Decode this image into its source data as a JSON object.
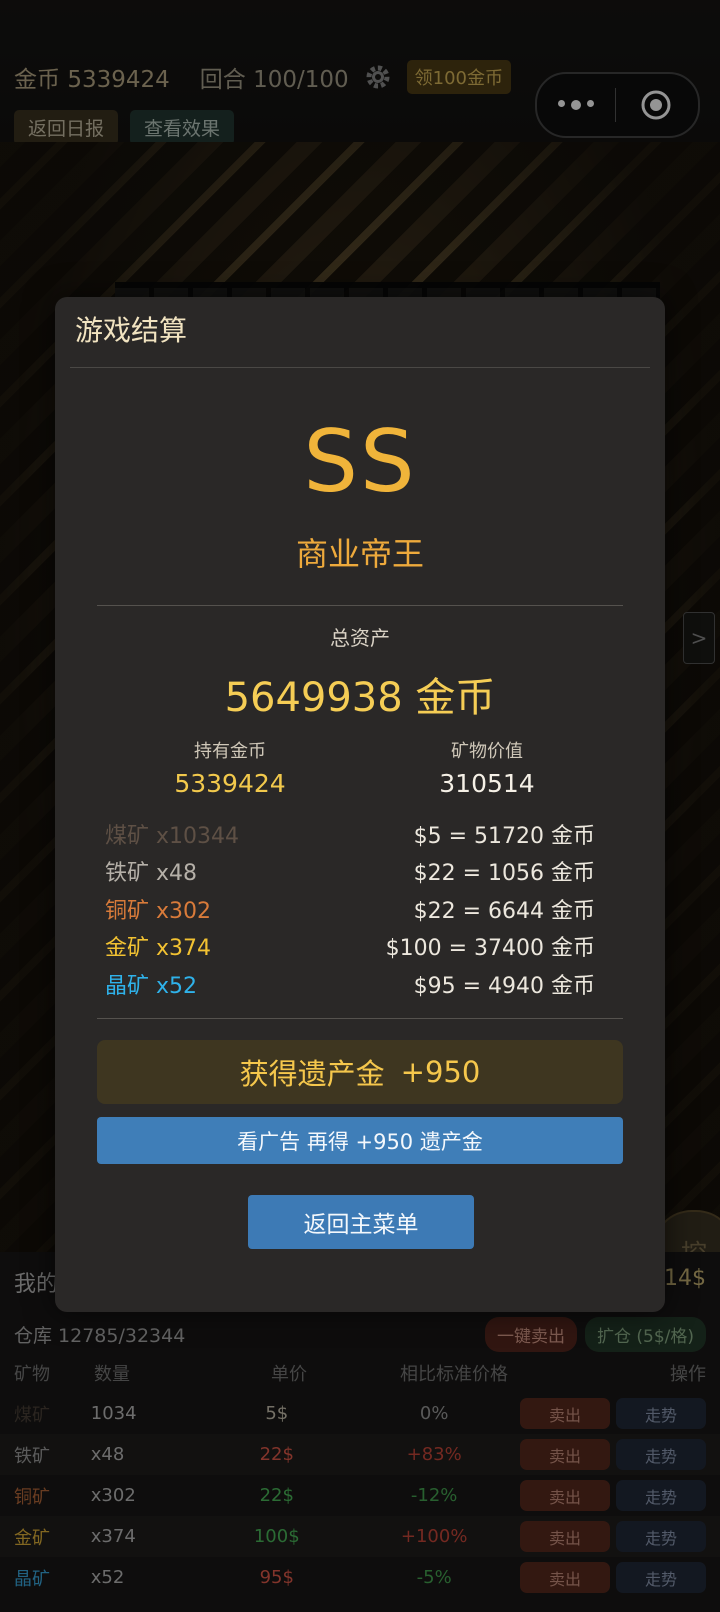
{
  "hud": {
    "coins_label": "金币",
    "coins_value": "5339424",
    "round_label": "回合",
    "round_value": "100/100",
    "claim_badge": "领100金币",
    "daily_button": "返回日报",
    "effect_button": "查看效果"
  },
  "field": {
    "side_arrow": ">",
    "dig_button": "挖"
  },
  "warehouse": {
    "title": "我的",
    "total": "14$",
    "capacity": "仓库 12785/32344",
    "sell_all": "一键卖出",
    "expand": "扩仓 (5$/格)",
    "headers": [
      "矿物",
      "数量",
      "单价",
      "相比标准价格",
      "操作"
    ],
    "sell_label": "卖出",
    "trend_label": "走势",
    "rows": [
      {
        "name": "煤矿",
        "qty": "1034",
        "price": "5$",
        "diff": "0%",
        "name_color": "#4a4038",
        "price_color": "#c9c2b0",
        "diff_color": "#9a9a9a"
      },
      {
        "name": "铁矿",
        "qty": "x48",
        "price": "22$",
        "diff": "+83%",
        "name_color": "#9e9e9e",
        "price_color": "#e05a4a",
        "diff_color": "#c8473a"
      },
      {
        "name": "铜矿",
        "qty": "x302",
        "price": "22$",
        "diff": "-12%",
        "name_color": "#b5683a",
        "price_color": "#4bb85a",
        "diff_color": "#45a451"
      },
      {
        "name": "金矿",
        "qty": "x374",
        "price": "100$",
        "diff": "+100%",
        "name_color": "#e0b23a",
        "price_color": "#4bb85a",
        "diff_color": "#c8473a"
      },
      {
        "name": "晶矿",
        "qty": "x52",
        "price": "95$",
        "diff": "-5%",
        "name_color": "#3aa9e0",
        "price_color": "#e05a4a",
        "diff_color": "#45a451"
      }
    ]
  },
  "modal": {
    "title": "游戏结算",
    "grade": "SS",
    "grade_title": "商业帝王",
    "total_assets_label": "总资产",
    "total_assets_value": "5649938 金币",
    "held_coins_label": "持有金币",
    "held_coins_value": "5339424",
    "ore_value_label": "矿物价值",
    "ore_value_value": "310514",
    "ores": [
      {
        "left": "煤矿 x10344",
        "right": "$5 = 51720 金币",
        "color": "#5e5045"
      },
      {
        "left": "铁矿 x48",
        "right": "$22 = 1056 金币",
        "color": "#b5b0a8"
      },
      {
        "left": "铜矿 x302",
        "right": "$22 = 6644 金币",
        "color": "#d97b3a"
      },
      {
        "left": "金矿 x374",
        "right": "$100 = 37400 金币",
        "color": "#f2c232"
      },
      {
        "left": "晶矿 x52",
        "right": "$95 = 4940 金币",
        "color": "#2fb2ea"
      }
    ],
    "legacy_label": "获得遗产金",
    "legacy_value": "+950",
    "ad_button": "看广告 再得 +950 遗产金",
    "menu_button": "返回主菜单"
  }
}
